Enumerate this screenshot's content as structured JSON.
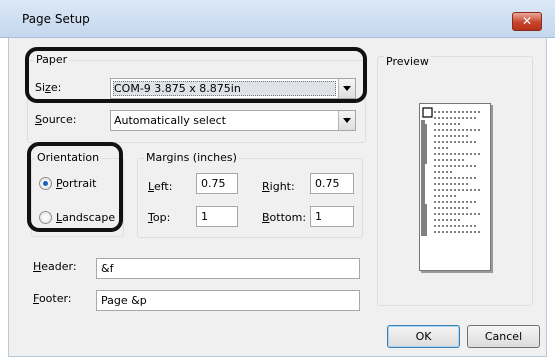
{
  "window": {
    "title": "Page Setup",
    "close_glyph": "✕"
  },
  "paper": {
    "legend": "Paper",
    "size_label_pre": "Si",
    "size_label_accel": "z",
    "size_label_post": "e:",
    "size_value": "COM-9 3.875 x 8.875in",
    "source_label_accel": "S",
    "source_label_rest": "ource:",
    "source_value": "Automatically select"
  },
  "orientation": {
    "legend": "Orientation",
    "portrait_accel": "P",
    "portrait_rest": "ortrait",
    "landscape_accel": "L",
    "landscape_rest": "andscape",
    "selected": "portrait"
  },
  "margins": {
    "legend": "Margins (inches)",
    "left_accel": "L",
    "left_rest": "eft:",
    "left_value": "0.75",
    "right_accel": "R",
    "right_rest": "ight:",
    "right_value": "0.75",
    "top_accel": "T",
    "top_rest": "op:",
    "top_value": "1",
    "bottom_accel": "B",
    "bottom_rest": "ottom:",
    "bottom_value": "1"
  },
  "header": {
    "label_accel": "H",
    "label_rest": "eader:",
    "value": "&f"
  },
  "footer": {
    "label_accel": "F",
    "label_rest": "ooter:",
    "value": "Page &p"
  },
  "preview": {
    "legend": "Preview"
  },
  "buttons": {
    "ok": "OK",
    "cancel": "Cancel"
  },
  "colors": {
    "title_bar": "#c5d7ee",
    "close_button": "#c7452d",
    "dialog_bg": "#f0f0f0",
    "highlight": "#111111"
  }
}
